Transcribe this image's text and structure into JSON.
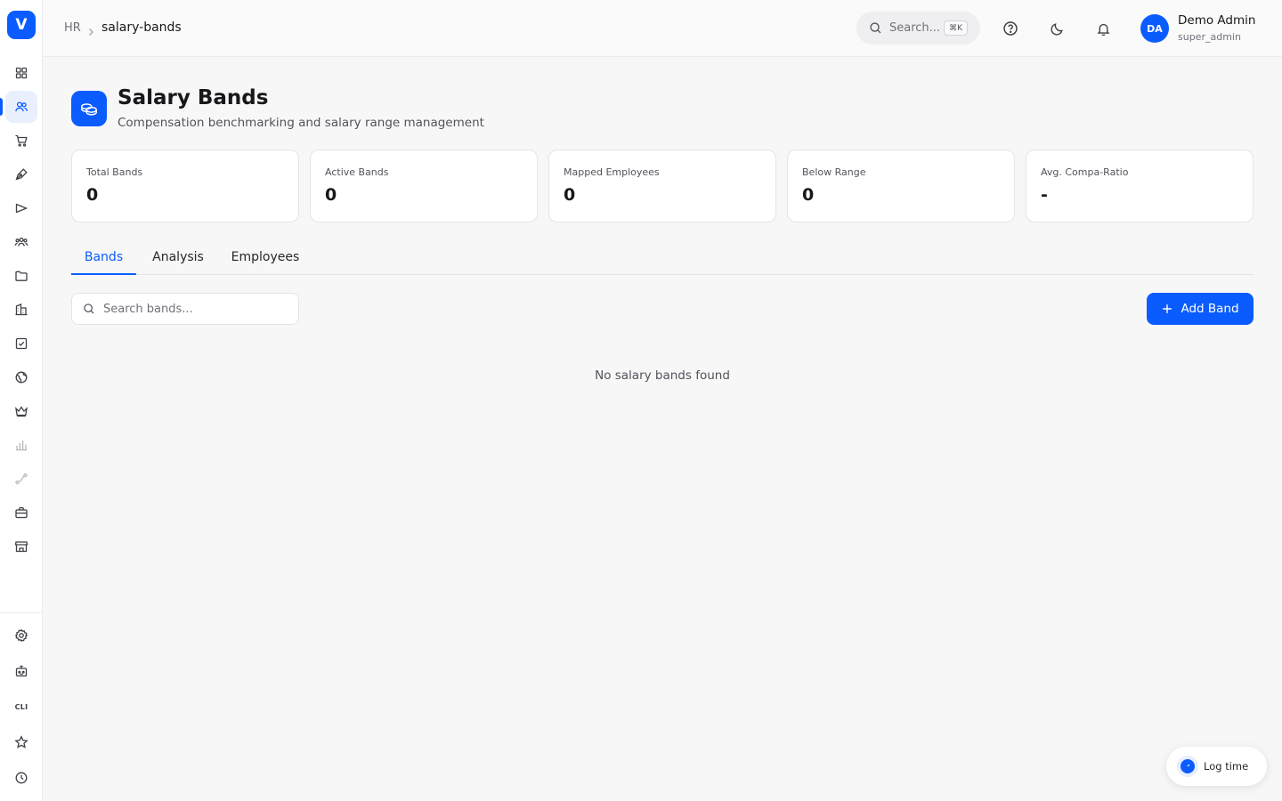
{
  "brand": {
    "logo_letter": "V",
    "accent": "#0b5cff"
  },
  "sidebar": {
    "items": [
      {
        "icon": "dashboard-grid-icon"
      },
      {
        "icon": "people-icon",
        "active": true
      },
      {
        "icon": "cart-icon"
      },
      {
        "icon": "pen-nib-icon"
      },
      {
        "icon": "megaphone-icon"
      },
      {
        "icon": "team-icon"
      },
      {
        "icon": "folder-icon"
      },
      {
        "icon": "building-icon"
      },
      {
        "icon": "checkbox-icon"
      },
      {
        "icon": "globe-icon"
      },
      {
        "icon": "crown-icon"
      },
      {
        "icon": "bar-chart-icon"
      },
      {
        "icon": "route-icon"
      },
      {
        "icon": "briefcase-icon"
      },
      {
        "icon": "store-icon"
      }
    ],
    "bottom_items": [
      {
        "icon": "settings-icon"
      },
      {
        "icon": "robot-icon"
      },
      {
        "icon": "cli-icon",
        "label": "CLI"
      },
      {
        "icon": "star-icon"
      },
      {
        "icon": "clock-icon"
      }
    ]
  },
  "header": {
    "breadcrumb": {
      "root": "HR",
      "current": "salary-bands"
    },
    "search": {
      "label": "Search...",
      "shortcut": "⌘K"
    },
    "user": {
      "initials": "DA",
      "name": "Demo Admin",
      "role": "super_admin"
    }
  },
  "page": {
    "title": "Salary Bands",
    "subtitle": "Compensation benchmarking and salary range management"
  },
  "stats": [
    {
      "label": "Total Bands",
      "value": "0"
    },
    {
      "label": "Active Bands",
      "value": "0"
    },
    {
      "label": "Mapped Employees",
      "value": "0"
    },
    {
      "label": "Below Range",
      "value": "0"
    },
    {
      "label": "Avg. Compa-Ratio",
      "value": "-"
    }
  ],
  "tabs": [
    {
      "label": "Bands",
      "active": true
    },
    {
      "label": "Analysis"
    },
    {
      "label": "Employees"
    }
  ],
  "toolbar": {
    "search_placeholder": "Search bands...",
    "add_label": "Add Band"
  },
  "empty_state": "No salary bands found",
  "log_time": {
    "label": "Log time"
  }
}
